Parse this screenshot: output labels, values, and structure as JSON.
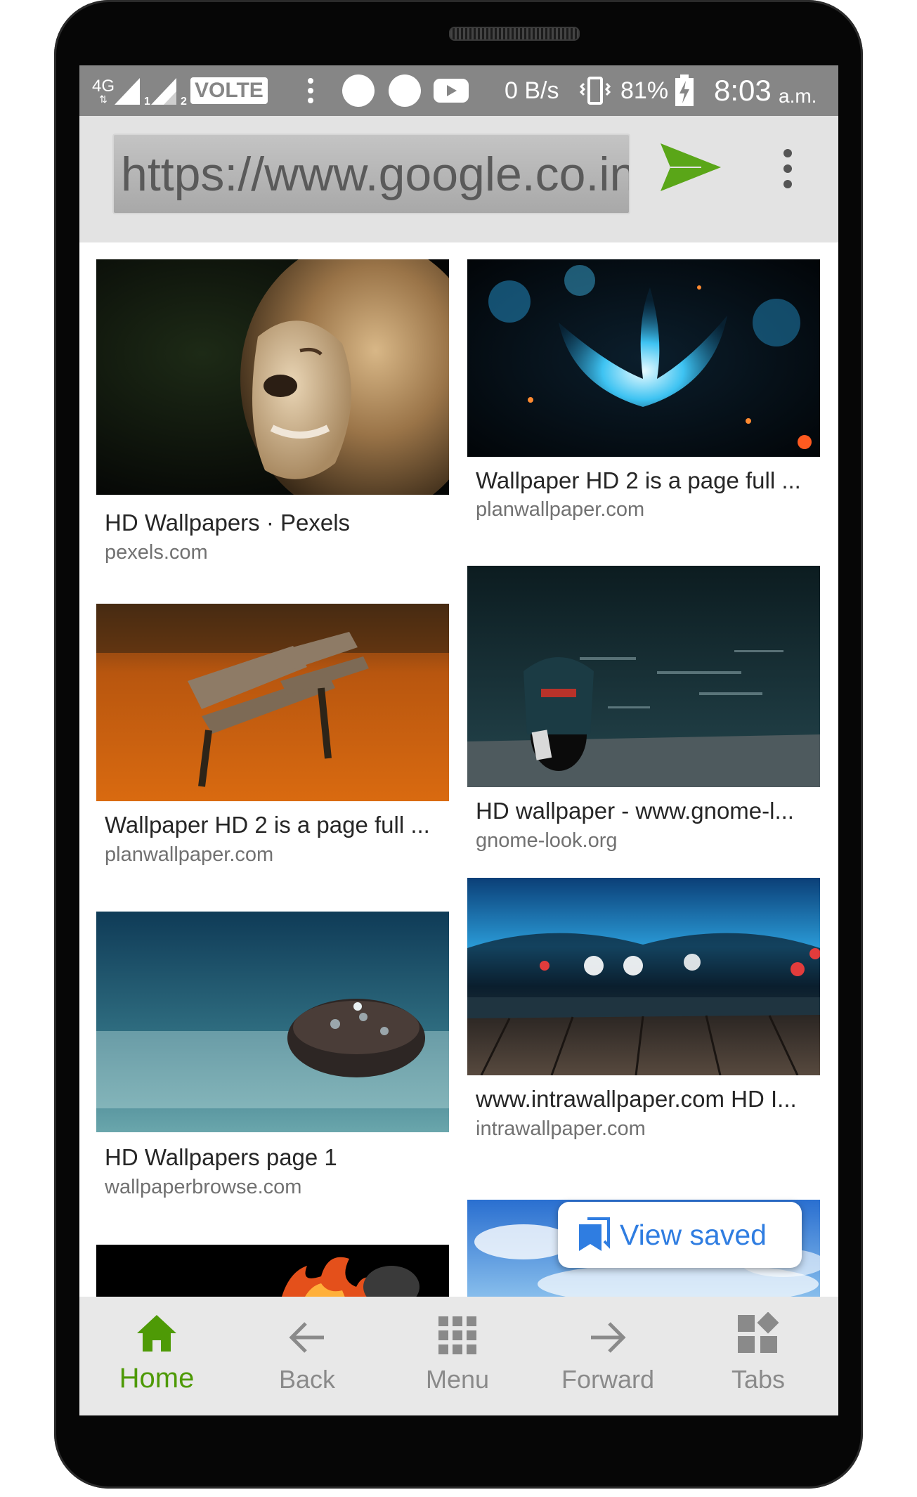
{
  "status_bar": {
    "network": "4G",
    "sim1": "1",
    "sim2": "2",
    "volte": "VOLTE",
    "speed": "0 B/s",
    "battery": "81%",
    "time": "8:03",
    "ampm": "a.m.",
    "icons": [
      "signal-icon",
      "signal-icon",
      "more-notifications-icon",
      "notification-dot-icon",
      "notification-dot-icon",
      "youtube-icon",
      "vibrate-icon",
      "battery-charging-icon"
    ]
  },
  "address_bar": {
    "url": "https://www.google.co.in/",
    "go_icon": "send-arrow-icon",
    "menu_icon": "vertical-dots-icon",
    "accent": "#5aa618"
  },
  "results": [
    {
      "title": "HD Wallpapers · Pexels",
      "source": "pexels.com",
      "image": "lion"
    },
    {
      "title": "Wallpaper HD 2 is a page full ...",
      "source": "planwallpaper.com",
      "image": "blue-flower"
    },
    {
      "title": "Wallpaper HD 2 is a page full ...",
      "source": "planwallpaper.com",
      "image": "autumn-bench"
    },
    {
      "title": "HD wallpaper - www.gnome-l...",
      "source": "gnome-look.org",
      "image": "motorcycle-dock"
    },
    {
      "title": "HD Wallpapers page 1",
      "source": "wallpaperbrowse.com",
      "image": "cookie-water-drops"
    },
    {
      "title": "www.intrawallpaper.com HD I...",
      "source": "intrawallpaper.com",
      "image": "wooden-deck-bokeh"
    },
    {
      "title": "",
      "source": "",
      "image": "fire-partial"
    },
    {
      "title": "",
      "source": "",
      "image": "blue-sky-partial"
    }
  ],
  "view_saved": {
    "label": "View saved",
    "icon": "bookmarks-icon",
    "color": "#2f7de1"
  },
  "bottom_nav": [
    {
      "label": "Home",
      "icon": "home-icon",
      "active": true
    },
    {
      "label": "Back",
      "icon": "back-arrow-icon",
      "active": false
    },
    {
      "label": "Menu",
      "icon": "grid-icon",
      "active": false
    },
    {
      "label": "Forward",
      "icon": "forward-arrow-icon",
      "active": false
    },
    {
      "label": "Tabs",
      "icon": "tabs-icon",
      "active": false
    }
  ],
  "colors": {
    "active_nav": "#4e9a06",
    "inactive_nav": "#8a8a8a",
    "status_bar": "#868686"
  }
}
